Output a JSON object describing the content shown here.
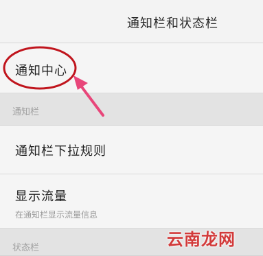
{
  "header": {
    "title": "通知栏和状态栏"
  },
  "items": [
    {
      "label": "通知中心"
    }
  ],
  "sections": {
    "notification_bar": {
      "title": "通知栏",
      "items": [
        {
          "label": "通知栏下拉规则"
        },
        {
          "label": "显示流量",
          "description": "在通知栏显示流量信息"
        }
      ]
    },
    "status_bar": {
      "title": "状态栏"
    }
  },
  "annotation": {
    "circle_color": "#c0151d",
    "arrow_color": "#e8467a"
  },
  "watermark": {
    "text": "云南龙网",
    "color": "#d23a3a"
  }
}
